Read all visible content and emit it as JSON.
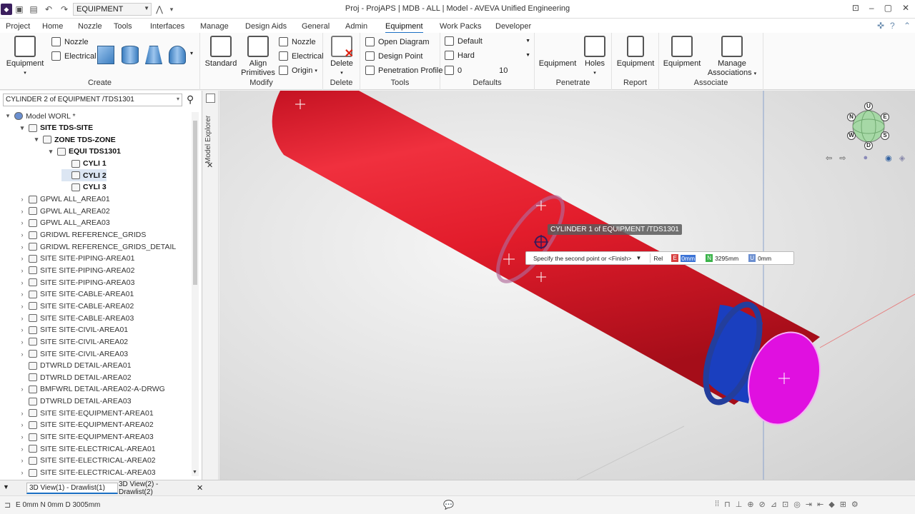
{
  "titlebar": {
    "equipment_combo": "EQUIPMENT",
    "window_title": "Proj - ProjAPS | MDB - ALL | Model - AVEVA Unified Engineering"
  },
  "tabs": [
    "Project",
    "Home",
    "Nozzle",
    "Tools",
    "Interfaces",
    "Manage",
    "Design Aids",
    "General",
    "Admin",
    "Equipment",
    "Work Packs",
    "Developer"
  ],
  "active_tab": "Equipment",
  "ribbon": {
    "create": {
      "label": "Create",
      "equipment": "Equipment",
      "nozzle": "Nozzle",
      "electrical": "Electrical"
    },
    "modify": {
      "label": "Modify",
      "standard": "Standard",
      "align1": "Align",
      "align2": "Primitives",
      "nozzle": "Nozzle",
      "electrical": "Electrical",
      "origin": "Origin"
    },
    "delete": {
      "label": "Delete",
      "delete": "Delete"
    },
    "tools": {
      "label": "Tools",
      "open_diagram": "Open Diagram",
      "design_point": "Design Point",
      "penetration_profile": "Penetration Profile"
    },
    "defaults": {
      "label": "Defaults",
      "default": "Default",
      "hard": "Hard",
      "num1": "0",
      "num2": "10"
    },
    "penetrate": {
      "label": "Penetrate",
      "equipment": "Equipment",
      "holes": "Holes"
    },
    "report": {
      "label": "Report",
      "equipment": "Equipment"
    },
    "associate": {
      "label": "Associate",
      "equipment": "Equipment",
      "manage1": "Manage",
      "manage2": "Associations"
    }
  },
  "explorer": {
    "search_value": "CYLINDER 2 of EQUIPMENT /TDS1301",
    "side_label": "Model Explorer",
    "tree": [
      {
        "label": "Model WORL *",
        "depth": 0,
        "exp": "▾",
        "bold": false
      },
      {
        "label": "SITE TDS-SITE",
        "depth": 1,
        "exp": "▾",
        "bold": true
      },
      {
        "label": "ZONE TDS-ZONE",
        "depth": 2,
        "exp": "▾",
        "bold": true
      },
      {
        "label": "EQUI TDS1301",
        "depth": 3,
        "exp": "▾",
        "bold": true
      },
      {
        "label": "CYLI 1",
        "depth": 4,
        "exp": "",
        "bold": true
      },
      {
        "label": "CYLI 2",
        "depth": 4,
        "exp": "",
        "bold": true,
        "sel": true
      },
      {
        "label": "CYLI 3",
        "depth": 4,
        "exp": "",
        "bold": true
      },
      {
        "label": "GPWL ALL_AREA01",
        "depth": 1,
        "exp": "›",
        "bold": false
      },
      {
        "label": "GPWL ALL_AREA02",
        "depth": 1,
        "exp": "›",
        "bold": false
      },
      {
        "label": "GPWL ALL_AREA03",
        "depth": 1,
        "exp": "›",
        "bold": false
      },
      {
        "label": "GRIDWL REFERENCE_GRIDS",
        "depth": 1,
        "exp": "›",
        "bold": false
      },
      {
        "label": "GRIDWL REFERENCE_GRIDS_DETAIL",
        "depth": 1,
        "exp": "›",
        "bold": false
      },
      {
        "label": "SITE SITE-PIPING-AREA01",
        "depth": 1,
        "exp": "›",
        "bold": false
      },
      {
        "label": "SITE SITE-PIPING-AREA02",
        "depth": 1,
        "exp": "›",
        "bold": false
      },
      {
        "label": "SITE SITE-PIPING-AREA03",
        "depth": 1,
        "exp": "›",
        "bold": false
      },
      {
        "label": "SITE SITE-CABLE-AREA01",
        "depth": 1,
        "exp": "›",
        "bold": false
      },
      {
        "label": "SITE SITE-CABLE-AREA02",
        "depth": 1,
        "exp": "›",
        "bold": false
      },
      {
        "label": "SITE SITE-CABLE-AREA03",
        "depth": 1,
        "exp": "›",
        "bold": false
      },
      {
        "label": "SITE SITE-CIVIL-AREA01",
        "depth": 1,
        "exp": "›",
        "bold": false
      },
      {
        "label": "SITE SITE-CIVIL-AREA02",
        "depth": 1,
        "exp": "›",
        "bold": false
      },
      {
        "label": "SITE SITE-CIVIL-AREA03",
        "depth": 1,
        "exp": "›",
        "bold": false
      },
      {
        "label": "DTWRLD DETAIL-AREA01",
        "depth": 1,
        "exp": "",
        "bold": false
      },
      {
        "label": "DTWRLD DETAIL-AREA02",
        "depth": 1,
        "exp": "",
        "bold": false
      },
      {
        "label": "BMFWRL DETAIL-AREA02-A-DRWG",
        "depth": 1,
        "exp": "›",
        "bold": false
      },
      {
        "label": "DTWRLD DETAIL-AREA03",
        "depth": 1,
        "exp": "",
        "bold": false
      },
      {
        "label": "SITE SITE-EQUIPMENT-AREA01",
        "depth": 1,
        "exp": "›",
        "bold": false
      },
      {
        "label": "SITE SITE-EQUIPMENT-AREA02",
        "depth": 1,
        "exp": "›",
        "bold": false
      },
      {
        "label": "SITE SITE-EQUIPMENT-AREA03",
        "depth": 1,
        "exp": "›",
        "bold": false
      },
      {
        "label": "SITE SITE-ELECTRICAL-AREA01",
        "depth": 1,
        "exp": "›",
        "bold": false
      },
      {
        "label": "SITE SITE-ELECTRICAL-AREA02",
        "depth": 1,
        "exp": "›",
        "bold": false
      },
      {
        "label": "SITE SITE-ELECTRICAL-AREA03",
        "depth": 1,
        "exp": "›",
        "bold": false
      }
    ]
  },
  "viewport": {
    "hover_tooltip": "CYLINDER 1 of EQUIPMENT /TDS1301",
    "prompt_text": "Specify the second point or <Finish>",
    "rel_label": "Rel",
    "e_value": "0mm",
    "n_value": "3295mm",
    "u_value": "0mm",
    "cube_labels": {
      "u": "U",
      "n": "N",
      "e": "E",
      "w": "W",
      "s": "S",
      "d": "D"
    },
    "colors": {
      "cylinder": "#e8202e",
      "end_cap": "#e010e0",
      "ring": "#1a3fbf"
    }
  },
  "bottom_tabs": [
    "3D View(1) - Drawlist(1)",
    "3D View(2) - Drawlist(2)"
  ],
  "status_text": "E 0mm N 0mm D 3005mm"
}
